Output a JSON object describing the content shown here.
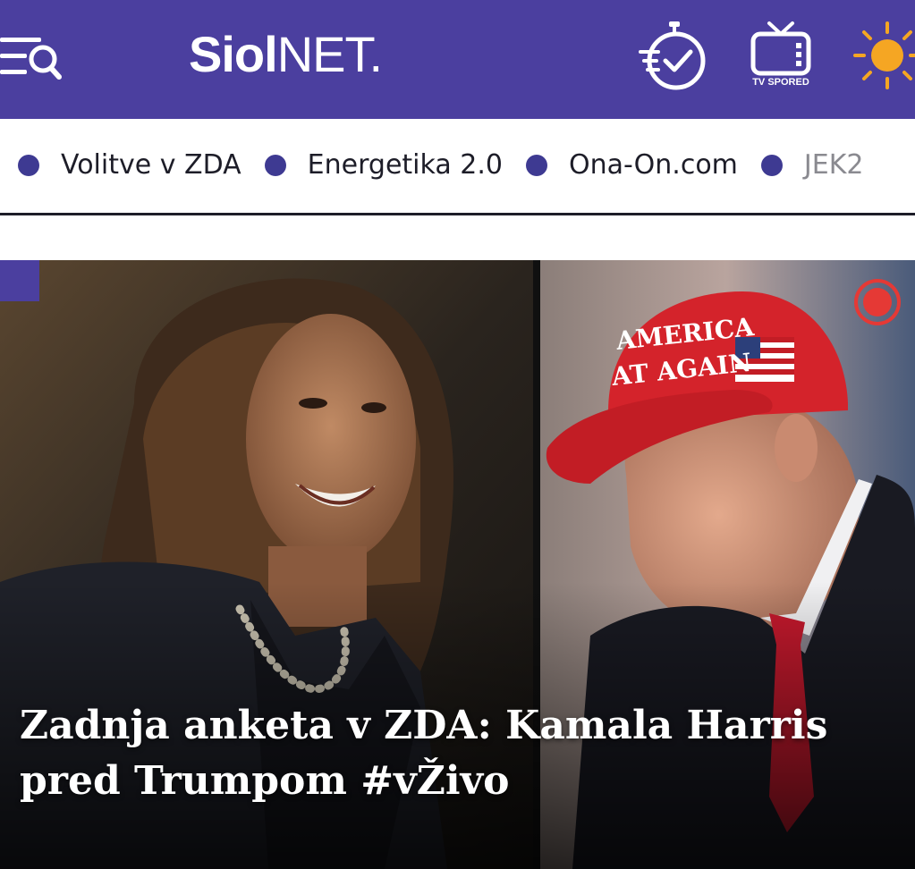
{
  "header": {
    "menu_icon": "menu-search-icon",
    "logo_bold": "Siol",
    "logo_light": "NET.",
    "timer_icon": "stopwatch-check-icon",
    "tv_icon": "tv-icon",
    "tv_label": "TV SPORED",
    "weather_icon": "sun-icon",
    "brand_color": "#4b3f9f"
  },
  "topics": [
    {
      "label": "Volitve v ZDA"
    },
    {
      "label": "Energetika 2.0"
    },
    {
      "label": "Ona-On.com"
    },
    {
      "label": "JEK2"
    }
  ],
  "hero": {
    "title": "Zadnja anketa v ZDA: Kamala Harris pred Trumpom #vŽivo",
    "cap_text_line1": "AMERICA",
    "cap_text_line2": "AT AGAIN",
    "live_indicator_color": "#e53935"
  }
}
